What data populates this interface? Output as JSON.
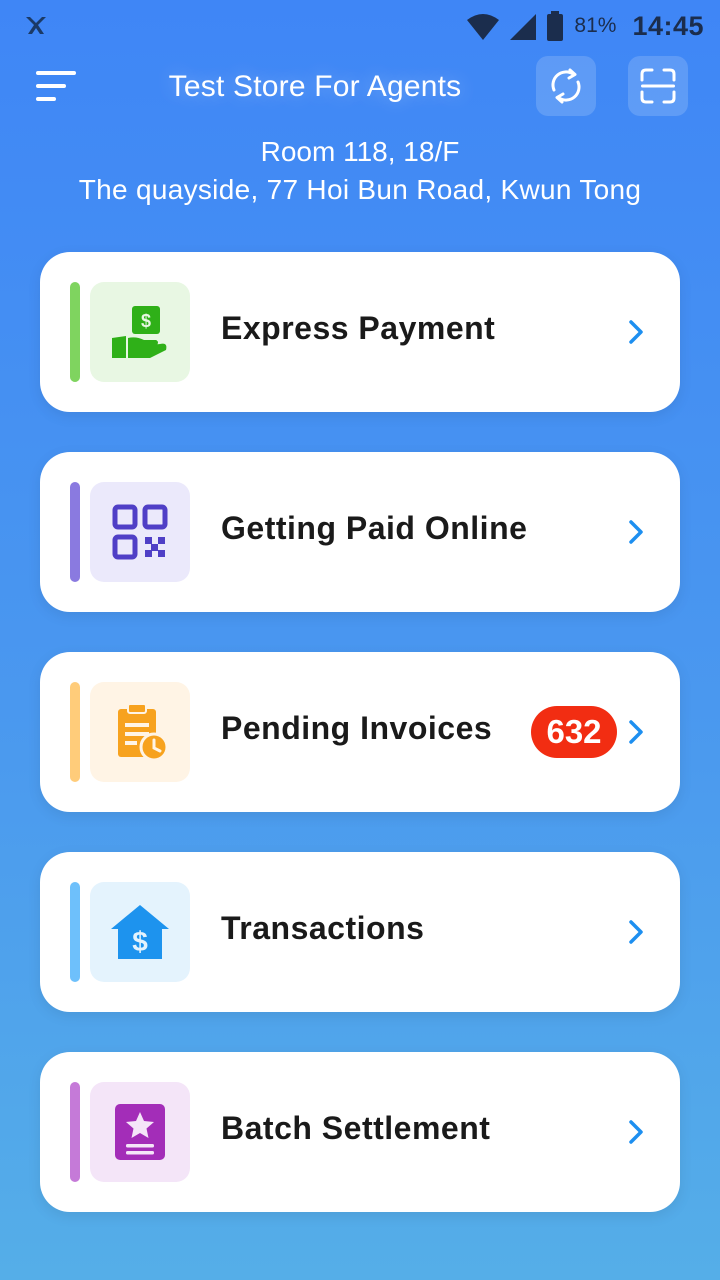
{
  "status_bar": {
    "battery": "81%",
    "time": "14:45",
    "icons": [
      "app-logo-icon",
      "wifi-icon",
      "signal-icon",
      "battery-icon"
    ]
  },
  "header": {
    "store_name": "Test Store For Agents",
    "icons": [
      "menu-icon",
      "refresh-icon",
      "scan-icon"
    ]
  },
  "address": {
    "line1": "Room 118, 18/F",
    "line2": "The quayside, 77 Hoi Bun Road, Kwun Tong"
  },
  "menu": {
    "items": [
      {
        "label": "Express Payment",
        "icon": "cash-hand-icon",
        "accent": "#7fd45f",
        "icon_bg": "#e8f7e3",
        "icon_color": "#2fb018"
      },
      {
        "label": "Getting Paid Online",
        "icon": "qr-code-icon",
        "accent": "#8a7ae0",
        "icon_bg": "#ebe9fb",
        "icon_color": "#4f3fc6"
      },
      {
        "label": "Pending Invoices",
        "icon": "clipboard-clock-icon",
        "accent": "#ffcc7a",
        "icon_bg": "#fff4e5",
        "icon_color": "#f7a21e",
        "badge": "632",
        "badge_color": "#f22d12"
      },
      {
        "label": "Transactions",
        "icon": "house-dollar-icon",
        "accent": "#6ec0fb",
        "icon_bg": "#e4f3fd",
        "icon_color": "#1d93ee"
      },
      {
        "label": "Batch Settlement",
        "icon": "star-document-icon",
        "accent": "#c57ad8",
        "icon_bg": "#f4e5f8",
        "icon_color": "#a32db8"
      }
    ],
    "chevron_color": "#1d8ff0"
  }
}
